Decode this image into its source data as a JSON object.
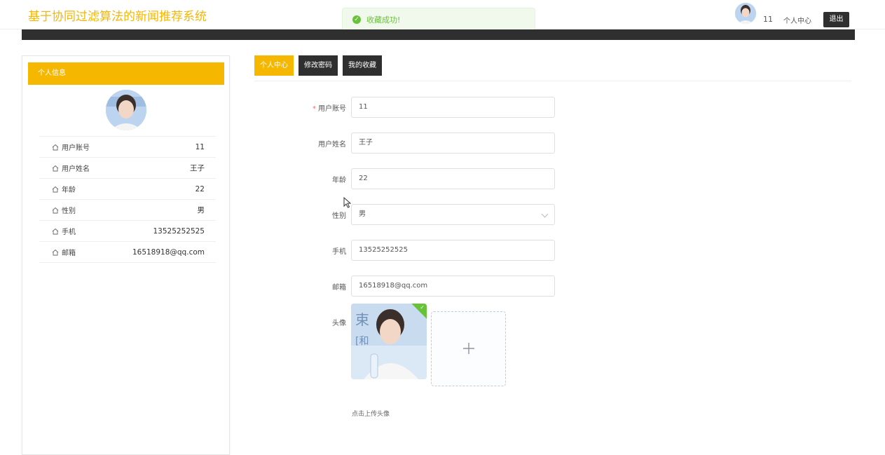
{
  "header": {
    "site_title": "基于协同过滤算法的新闻推荐系统",
    "username": "11",
    "personal_center": "个人中心",
    "logout": "退出"
  },
  "toast": {
    "message": "收藏成功!",
    "icon": "check-circle-icon",
    "color": "#67c23a"
  },
  "sidebar": {
    "title": "个人信息",
    "rows": [
      {
        "key": "用户账号",
        "value": "11"
      },
      {
        "key": "用户姓名",
        "value": "王子"
      },
      {
        "key": "年龄",
        "value": "22"
      },
      {
        "key": "性别",
        "value": "男"
      },
      {
        "key": "手机",
        "value": "13525252525"
      },
      {
        "key": "邮箱",
        "value": "16518918@qq.com"
      }
    ]
  },
  "tabs": [
    {
      "label": "个人中心",
      "active": true
    },
    {
      "label": "修改密码",
      "active": false
    },
    {
      "label": "我的收藏",
      "active": false
    }
  ],
  "form": {
    "account_label": "用户账号",
    "account_value": "11",
    "name_label": "用户姓名",
    "name_value": "王子",
    "age_label": "年龄",
    "age_value": "22",
    "gender_label": "性别",
    "gender_value": "男",
    "phone_label": "手机",
    "phone_value": "13525252525",
    "email_label": "邮箱",
    "email_value": "16518918@qq.com",
    "avatar_label": "头像",
    "upload_hint": "点击上传头像"
  },
  "colors": {
    "accent": "#f5b700",
    "dark": "#2f2f2f",
    "success": "#67c23a"
  }
}
